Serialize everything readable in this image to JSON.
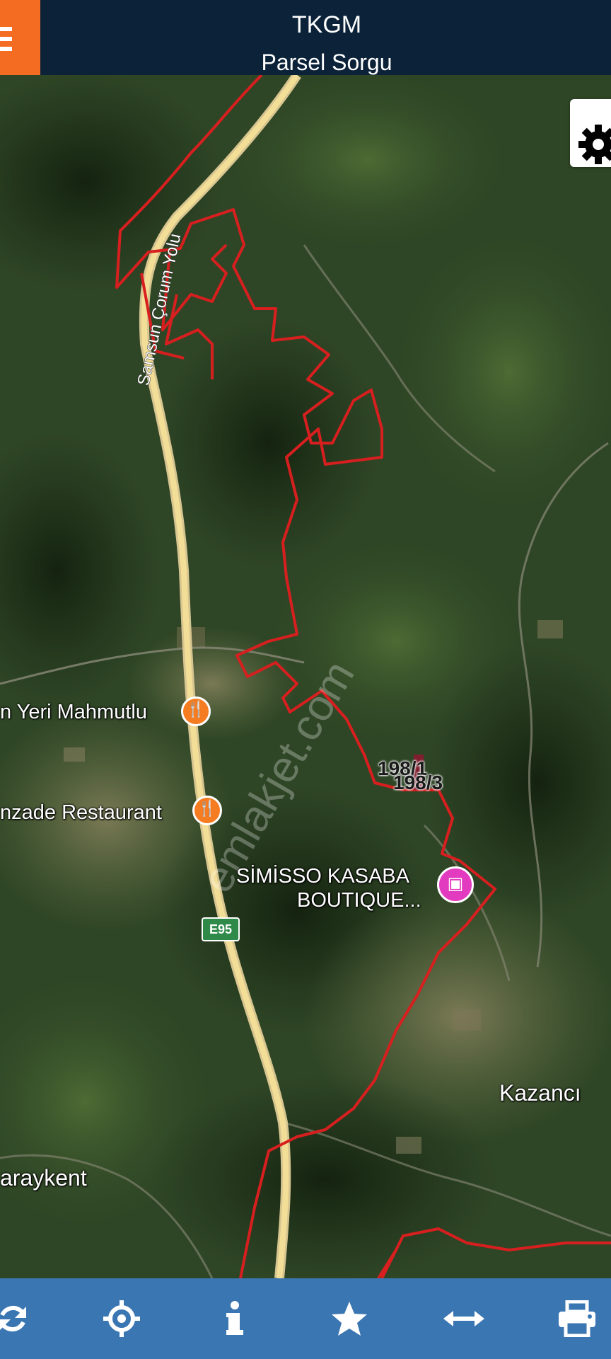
{
  "header": {
    "title": "TKGM",
    "subtitle": "Parsel Sorgu",
    "menu_icon": "hamburger-menu-icon"
  },
  "map": {
    "settings_icon": "gear-icon",
    "road_label": "Samsun Çorum Yolu",
    "highway_shield": "E95",
    "watermark": "emlakjet.com",
    "places": {
      "restaurant_1": "n Yeri Mahmutlu",
      "restaurant_2": "nzade Restaurant",
      "hotel_line1": "SİMİSSO KASABA",
      "hotel_line2": "BOUTIQUE...",
      "village_1": "Kazancı",
      "village_2": "araykent"
    },
    "parcels": {
      "parcel_1": "198/1",
      "parcel_2": "198/3"
    },
    "colors": {
      "boundary": "#d81f1f",
      "restaurant_pin": "#f57c21",
      "hotel_pin": "#e33bbf",
      "road": "#f5d67a"
    }
  },
  "toolbar": {
    "refresh": "refresh-icon",
    "locate": "crosshair-icon",
    "info": "info-icon",
    "favorite": "star-icon",
    "measure": "measure-icon",
    "print": "print-icon"
  }
}
